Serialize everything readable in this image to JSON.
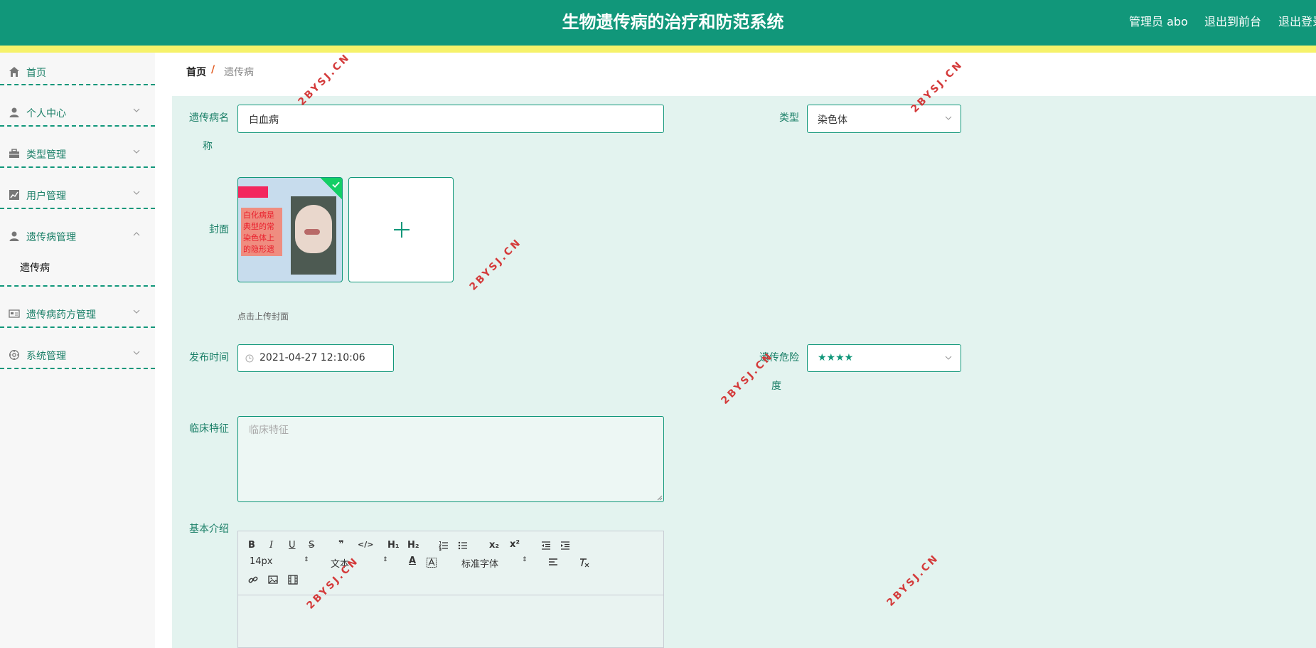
{
  "header": {
    "title": "生物遗传病的治疗和防范系统",
    "admin_label": "管理员 abo",
    "to_frontend": "退出到前台",
    "logout": "退出登录"
  },
  "colors": {
    "primary": "#11977a",
    "stripe": "#f6f26a",
    "form_bg": "#e3f3ef",
    "watermark": "#d43a3a"
  },
  "sidebar": {
    "items": [
      {
        "label": "首页",
        "icon": "home-icon"
      },
      {
        "label": "个人中心",
        "icon": "user-icon"
      },
      {
        "label": "类型管理",
        "icon": "briefcase-icon"
      },
      {
        "label": "用户管理",
        "icon": "chart-icon"
      },
      {
        "label": "遗传病管理",
        "icon": "user-icon",
        "expanded": true
      },
      {
        "label": "遗传病药方管理",
        "icon": "card-icon"
      },
      {
        "label": "系统管理",
        "icon": "settings-icon"
      }
    ],
    "subitem": "遗传病"
  },
  "breadcrumb": {
    "home": "首页",
    "separator": "/",
    "current": "遗传病"
  },
  "form": {
    "name_label_1": "遗传病名",
    "name_label_2": "称",
    "name_value": "白血病",
    "type_label": "类型",
    "type_value": "染色体",
    "cover_label": "封面",
    "cover_text": "白化病是典型的常染色体上的隐形遗传病",
    "cover_hint": "点击上传封面",
    "publish_label": "发布时间",
    "publish_value": "2021-04-27 12:10:06",
    "danger_label_1": "遗传危险",
    "danger_label_2": "度",
    "danger_value": "★★★★",
    "clinical_label": "临床特征",
    "clinical_placeholder": "临床特征",
    "intro_label": "基本介绍"
  },
  "editor": {
    "font_size": "14px",
    "paragraph": "文本",
    "font_family": "标准字体",
    "bold": "B",
    "italic": "I",
    "underline": "U",
    "strike": "S",
    "quote": "❞",
    "code": "</>",
    "h1": "H₁",
    "h2": "H₂",
    "subscript": "x₂",
    "superscript": "x²"
  },
  "watermark": "2BYSJ.CN"
}
